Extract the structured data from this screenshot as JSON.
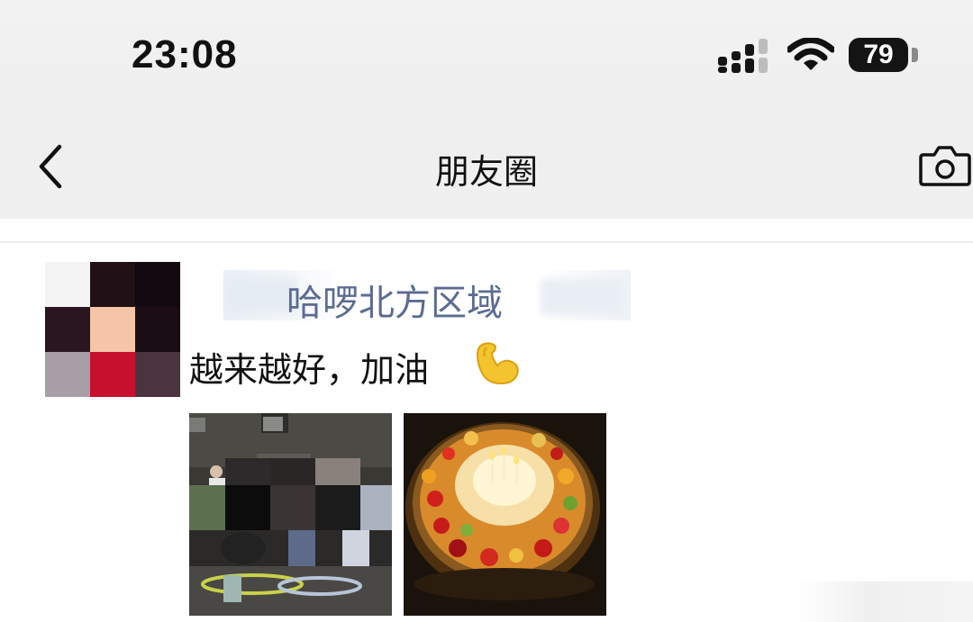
{
  "status_bar": {
    "time": "23:08",
    "battery": "79",
    "icons": [
      "signal-icon",
      "wifi-icon",
      "battery-icon"
    ]
  },
  "nav": {
    "title": "朋友圈",
    "back_icon": "chevron-left-icon",
    "camera_icon": "camera-icon"
  },
  "post": {
    "username": "哈啰北方区域",
    "text": "越来越好，加油",
    "emoji": "flexed-biceps-emoji",
    "photos": [
      {
        "subject": "group-photo-with-bikes"
      },
      {
        "subject": "fruit-birthday-cake-with-candles"
      }
    ]
  },
  "colors": {
    "header_bg": "#f0f0f0",
    "username": "#5b6b92",
    "text": "#111111",
    "battery_bg": "#141414"
  }
}
